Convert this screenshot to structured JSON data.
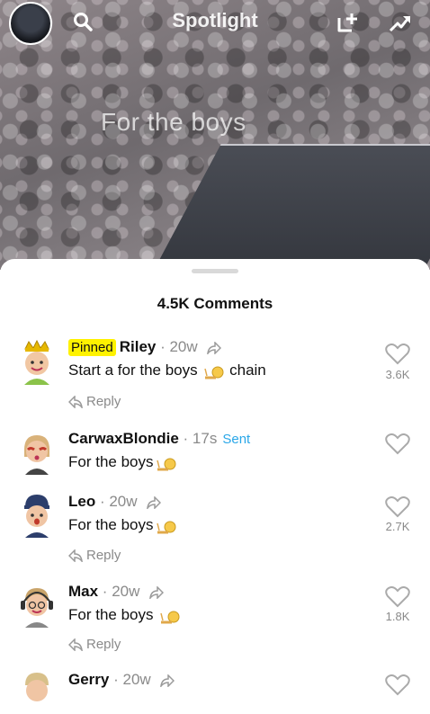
{
  "header": {
    "title": "Spotlight",
    "video_caption": "For the boys"
  },
  "comments_count": "4.5K Comments",
  "comments": [
    {
      "pinned": "Pinned",
      "name": "Riley",
      "age": "20w",
      "text_before": "Start a for the boys",
      "text_after": "chain",
      "reply": "Reply",
      "likes": "3.6K"
    },
    {
      "name": "CarwaxBlondie",
      "age": "17s",
      "status": "Sent",
      "text": "For the boys",
      "likes": ""
    },
    {
      "name": "Leo",
      "age": "20w",
      "text": "For the boys",
      "reply": "Reply",
      "likes": "2.7K"
    },
    {
      "name": "Max",
      "age": "20w",
      "text": "For the boys",
      "reply": "Reply",
      "likes": "1.8K"
    },
    {
      "name": "Gerry",
      "age": "20w"
    }
  ],
  "colors": {
    "pinned_bg": "#fff200",
    "sent": "#2aa7e8",
    "muted": "#8a8a8a"
  },
  "icons": [
    "search-icon",
    "add-story-icon",
    "trend-arrow-icon",
    "heart-icon",
    "share-icon",
    "reply-icon",
    "snail-emoji-icon"
  ]
}
